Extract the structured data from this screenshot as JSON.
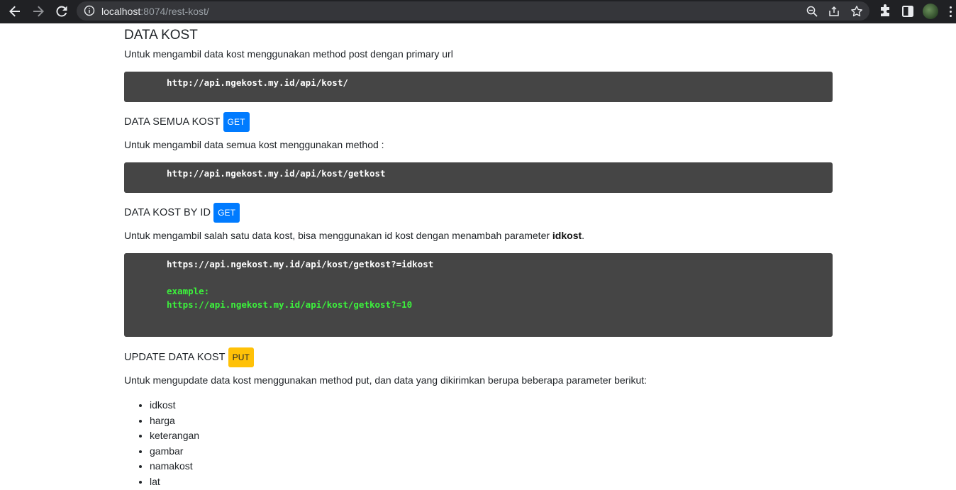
{
  "browser": {
    "url_host": "localhost",
    "url_rest": ":8074/rest-kost/"
  },
  "page": {
    "title": "DATA KOST",
    "intro": "Untuk mengambil data kost menggunakan method post dengan primary url",
    "base_url": "http://api.ngekost.my.id/api/kost/",
    "sections": [
      {
        "heading": "DATA SEMUA KOST",
        "method": "GET",
        "desc": "Untuk mengambil data semua kost menggunakan method :",
        "endpoint": "http://api.ngekost.my.id/api/kost/getkost"
      },
      {
        "heading": "DATA KOST BY ID",
        "method": "GET",
        "desc_before": "Untuk mengambil salah satu data kost, bisa menggunakan id kost dengan menambah parameter ",
        "desc_bold": "idkost",
        "desc_after": ".",
        "endpoint": "https://api.ngekost.my.id/api/kost/getkost?=idkost",
        "example_label": "example:",
        "example_url": "https://api.ngekost.my.id/api/kost/getkost?=10"
      },
      {
        "heading": "UPDATE DATA KOST",
        "method": "PUT",
        "desc": "Untuk mengupdate data kost menggunakan method put, dan data yang dikirimkan berupa beberapa parameter berikut:",
        "params": [
          "idkost",
          "harga",
          "keterangan",
          "gambar",
          "namakost",
          "lat"
        ]
      }
    ]
  },
  "colors": {
    "get_badge": "#007bff",
    "put_badge": "#ffc107",
    "code_bg": "#454545",
    "example_text": "#3cf23c"
  }
}
